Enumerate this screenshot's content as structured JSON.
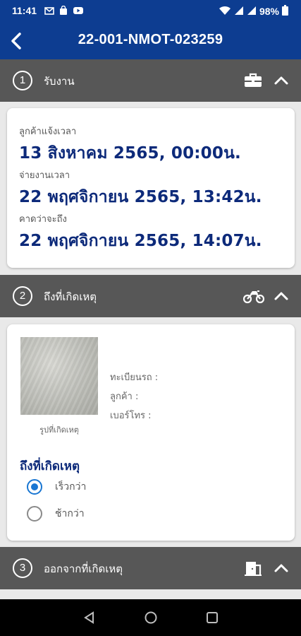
{
  "status_bar": {
    "time": "11:41",
    "battery": "98%",
    "notification_icons": [
      "gmail-icon",
      "shopping-bag-icon",
      "youtube-icon"
    ]
  },
  "header": {
    "title": "22-001-NMOT-023259",
    "back_icon": "back-arrow-icon",
    "background_color": "#0d3d91"
  },
  "sections": [
    {
      "number": "1",
      "label": "รับงาน",
      "icon": "briefcase-icon",
      "expanded": true
    },
    {
      "number": "2",
      "label": "ถึงที่เกิดเหตุ",
      "icon": "motorcycle-icon",
      "expanded": true
    },
    {
      "number": "3",
      "label": "ออกจากที่เกิดเหตุ",
      "icon": "exit-door-icon",
      "expanded": true
    }
  ],
  "job_card": {
    "notify_label": "ลูกค้าแจ้งเวลา",
    "notify_value": "13 สิงหาคม 2565, 00:00น.",
    "assign_label": "จ่ายงานเวลา",
    "assign_value": "22 พฤศจิกายน 2565, 13:42น.",
    "eta_label": "คาดว่าจะถึง",
    "eta_value": "22 พฤศจิกายน 2565, 14:07น."
  },
  "arrival_card": {
    "photo_caption": "รูปที่เกิดเหตุ",
    "plate_label": "ทะเบียนรถ :",
    "customer_label": "ลูกค้า :",
    "phone_label": "เบอร์โทร :",
    "arrival_title": "ถึงที่เกิดเหตุ",
    "options": [
      {
        "label": "เร็วกว่า",
        "selected": true
      },
      {
        "label": "ช้ากว่า",
        "selected": false
      }
    ]
  },
  "colors": {
    "accent_blue": "#0d2a7a",
    "section_header": "#575757",
    "radio_selected": "#1976d2"
  }
}
